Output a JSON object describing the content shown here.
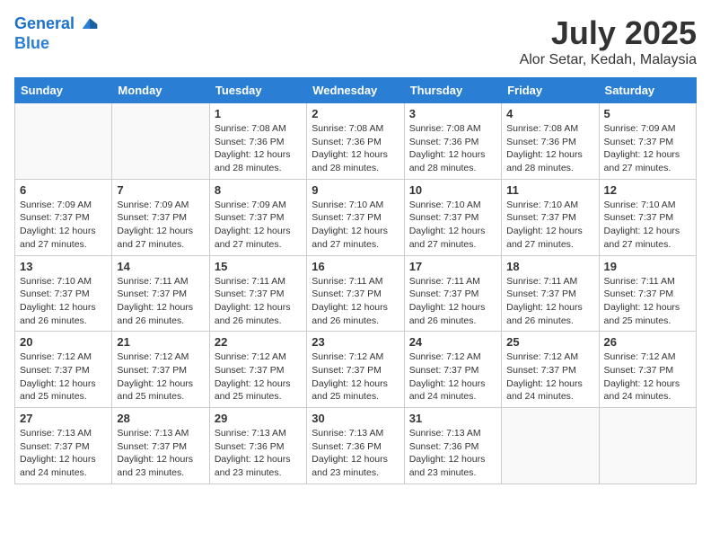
{
  "logo": {
    "line1": "General",
    "line2": "Blue"
  },
  "title": "July 2025",
  "location": "Alor Setar, Kedah, Malaysia",
  "headers": [
    "Sunday",
    "Monday",
    "Tuesday",
    "Wednesday",
    "Thursday",
    "Friday",
    "Saturday"
  ],
  "weeks": [
    [
      {
        "day": "",
        "content": ""
      },
      {
        "day": "",
        "content": ""
      },
      {
        "day": "1",
        "content": "Sunrise: 7:08 AM\nSunset: 7:36 PM\nDaylight: 12 hours\nand 28 minutes."
      },
      {
        "day": "2",
        "content": "Sunrise: 7:08 AM\nSunset: 7:36 PM\nDaylight: 12 hours\nand 28 minutes."
      },
      {
        "day": "3",
        "content": "Sunrise: 7:08 AM\nSunset: 7:36 PM\nDaylight: 12 hours\nand 28 minutes."
      },
      {
        "day": "4",
        "content": "Sunrise: 7:08 AM\nSunset: 7:36 PM\nDaylight: 12 hours\nand 28 minutes."
      },
      {
        "day": "5",
        "content": "Sunrise: 7:09 AM\nSunset: 7:37 PM\nDaylight: 12 hours\nand 27 minutes."
      }
    ],
    [
      {
        "day": "6",
        "content": "Sunrise: 7:09 AM\nSunset: 7:37 PM\nDaylight: 12 hours\nand 27 minutes."
      },
      {
        "day": "7",
        "content": "Sunrise: 7:09 AM\nSunset: 7:37 PM\nDaylight: 12 hours\nand 27 minutes."
      },
      {
        "day": "8",
        "content": "Sunrise: 7:09 AM\nSunset: 7:37 PM\nDaylight: 12 hours\nand 27 minutes."
      },
      {
        "day": "9",
        "content": "Sunrise: 7:10 AM\nSunset: 7:37 PM\nDaylight: 12 hours\nand 27 minutes."
      },
      {
        "day": "10",
        "content": "Sunrise: 7:10 AM\nSunset: 7:37 PM\nDaylight: 12 hours\nand 27 minutes."
      },
      {
        "day": "11",
        "content": "Sunrise: 7:10 AM\nSunset: 7:37 PM\nDaylight: 12 hours\nand 27 minutes."
      },
      {
        "day": "12",
        "content": "Sunrise: 7:10 AM\nSunset: 7:37 PM\nDaylight: 12 hours\nand 27 minutes."
      }
    ],
    [
      {
        "day": "13",
        "content": "Sunrise: 7:10 AM\nSunset: 7:37 PM\nDaylight: 12 hours\nand 26 minutes."
      },
      {
        "day": "14",
        "content": "Sunrise: 7:11 AM\nSunset: 7:37 PM\nDaylight: 12 hours\nand 26 minutes."
      },
      {
        "day": "15",
        "content": "Sunrise: 7:11 AM\nSunset: 7:37 PM\nDaylight: 12 hours\nand 26 minutes."
      },
      {
        "day": "16",
        "content": "Sunrise: 7:11 AM\nSunset: 7:37 PM\nDaylight: 12 hours\nand 26 minutes."
      },
      {
        "day": "17",
        "content": "Sunrise: 7:11 AM\nSunset: 7:37 PM\nDaylight: 12 hours\nand 26 minutes."
      },
      {
        "day": "18",
        "content": "Sunrise: 7:11 AM\nSunset: 7:37 PM\nDaylight: 12 hours\nand 26 minutes."
      },
      {
        "day": "19",
        "content": "Sunrise: 7:11 AM\nSunset: 7:37 PM\nDaylight: 12 hours\nand 25 minutes."
      }
    ],
    [
      {
        "day": "20",
        "content": "Sunrise: 7:12 AM\nSunset: 7:37 PM\nDaylight: 12 hours\nand 25 minutes."
      },
      {
        "day": "21",
        "content": "Sunrise: 7:12 AM\nSunset: 7:37 PM\nDaylight: 12 hours\nand 25 minutes."
      },
      {
        "day": "22",
        "content": "Sunrise: 7:12 AM\nSunset: 7:37 PM\nDaylight: 12 hours\nand 25 minutes."
      },
      {
        "day": "23",
        "content": "Sunrise: 7:12 AM\nSunset: 7:37 PM\nDaylight: 12 hours\nand 25 minutes."
      },
      {
        "day": "24",
        "content": "Sunrise: 7:12 AM\nSunset: 7:37 PM\nDaylight: 12 hours\nand 24 minutes."
      },
      {
        "day": "25",
        "content": "Sunrise: 7:12 AM\nSunset: 7:37 PM\nDaylight: 12 hours\nand 24 minutes."
      },
      {
        "day": "26",
        "content": "Sunrise: 7:12 AM\nSunset: 7:37 PM\nDaylight: 12 hours\nand 24 minutes."
      }
    ],
    [
      {
        "day": "27",
        "content": "Sunrise: 7:13 AM\nSunset: 7:37 PM\nDaylight: 12 hours\nand 24 minutes."
      },
      {
        "day": "28",
        "content": "Sunrise: 7:13 AM\nSunset: 7:37 PM\nDaylight: 12 hours\nand 23 minutes."
      },
      {
        "day": "29",
        "content": "Sunrise: 7:13 AM\nSunset: 7:36 PM\nDaylight: 12 hours\nand 23 minutes."
      },
      {
        "day": "30",
        "content": "Sunrise: 7:13 AM\nSunset: 7:36 PM\nDaylight: 12 hours\nand 23 minutes."
      },
      {
        "day": "31",
        "content": "Sunrise: 7:13 AM\nSunset: 7:36 PM\nDaylight: 12 hours\nand 23 minutes."
      },
      {
        "day": "",
        "content": ""
      },
      {
        "day": "",
        "content": ""
      }
    ]
  ]
}
